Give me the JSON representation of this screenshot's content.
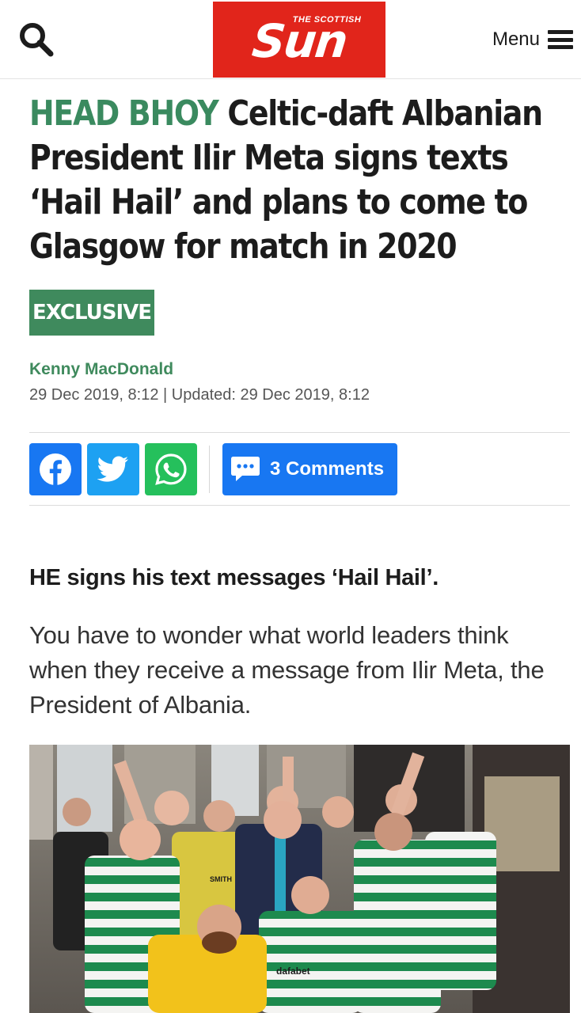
{
  "header": {
    "logo_top": "THE SCOTTISH",
    "logo_main": "Sun",
    "menu_label": "Menu",
    "brand_color": "#e1251b"
  },
  "article": {
    "kicker": "HEAD BHOY",
    "headline": "Celtic-daft Albanian President Ilir Meta signs texts ‘Hail Hail’ and plans to come to Glasgow for match in 2020",
    "label": "EXCLUSIVE",
    "author": "Kenny MacDonald",
    "dateline": "29 Dec 2019, 8:12 | Updated: 29 Dec 2019, 8:12",
    "lede": "HE signs his text messages ‘Hail Hail’.",
    "paragraph": "You have to wonder what world leaders think when they receive a message from Ilir Meta, the President of Albania.",
    "accent_color": "#3f8a5d",
    "image_text": {
      "shirt_sponsor": "dafabet",
      "nameplate": "SMITH"
    }
  },
  "share": {
    "facebook_icon": "facebook-icon",
    "twitter_icon": "twitter-icon",
    "whatsapp_icon": "whatsapp-icon",
    "comments_label": "3 Comments",
    "comment_icon": "speech-bubble-icon"
  }
}
